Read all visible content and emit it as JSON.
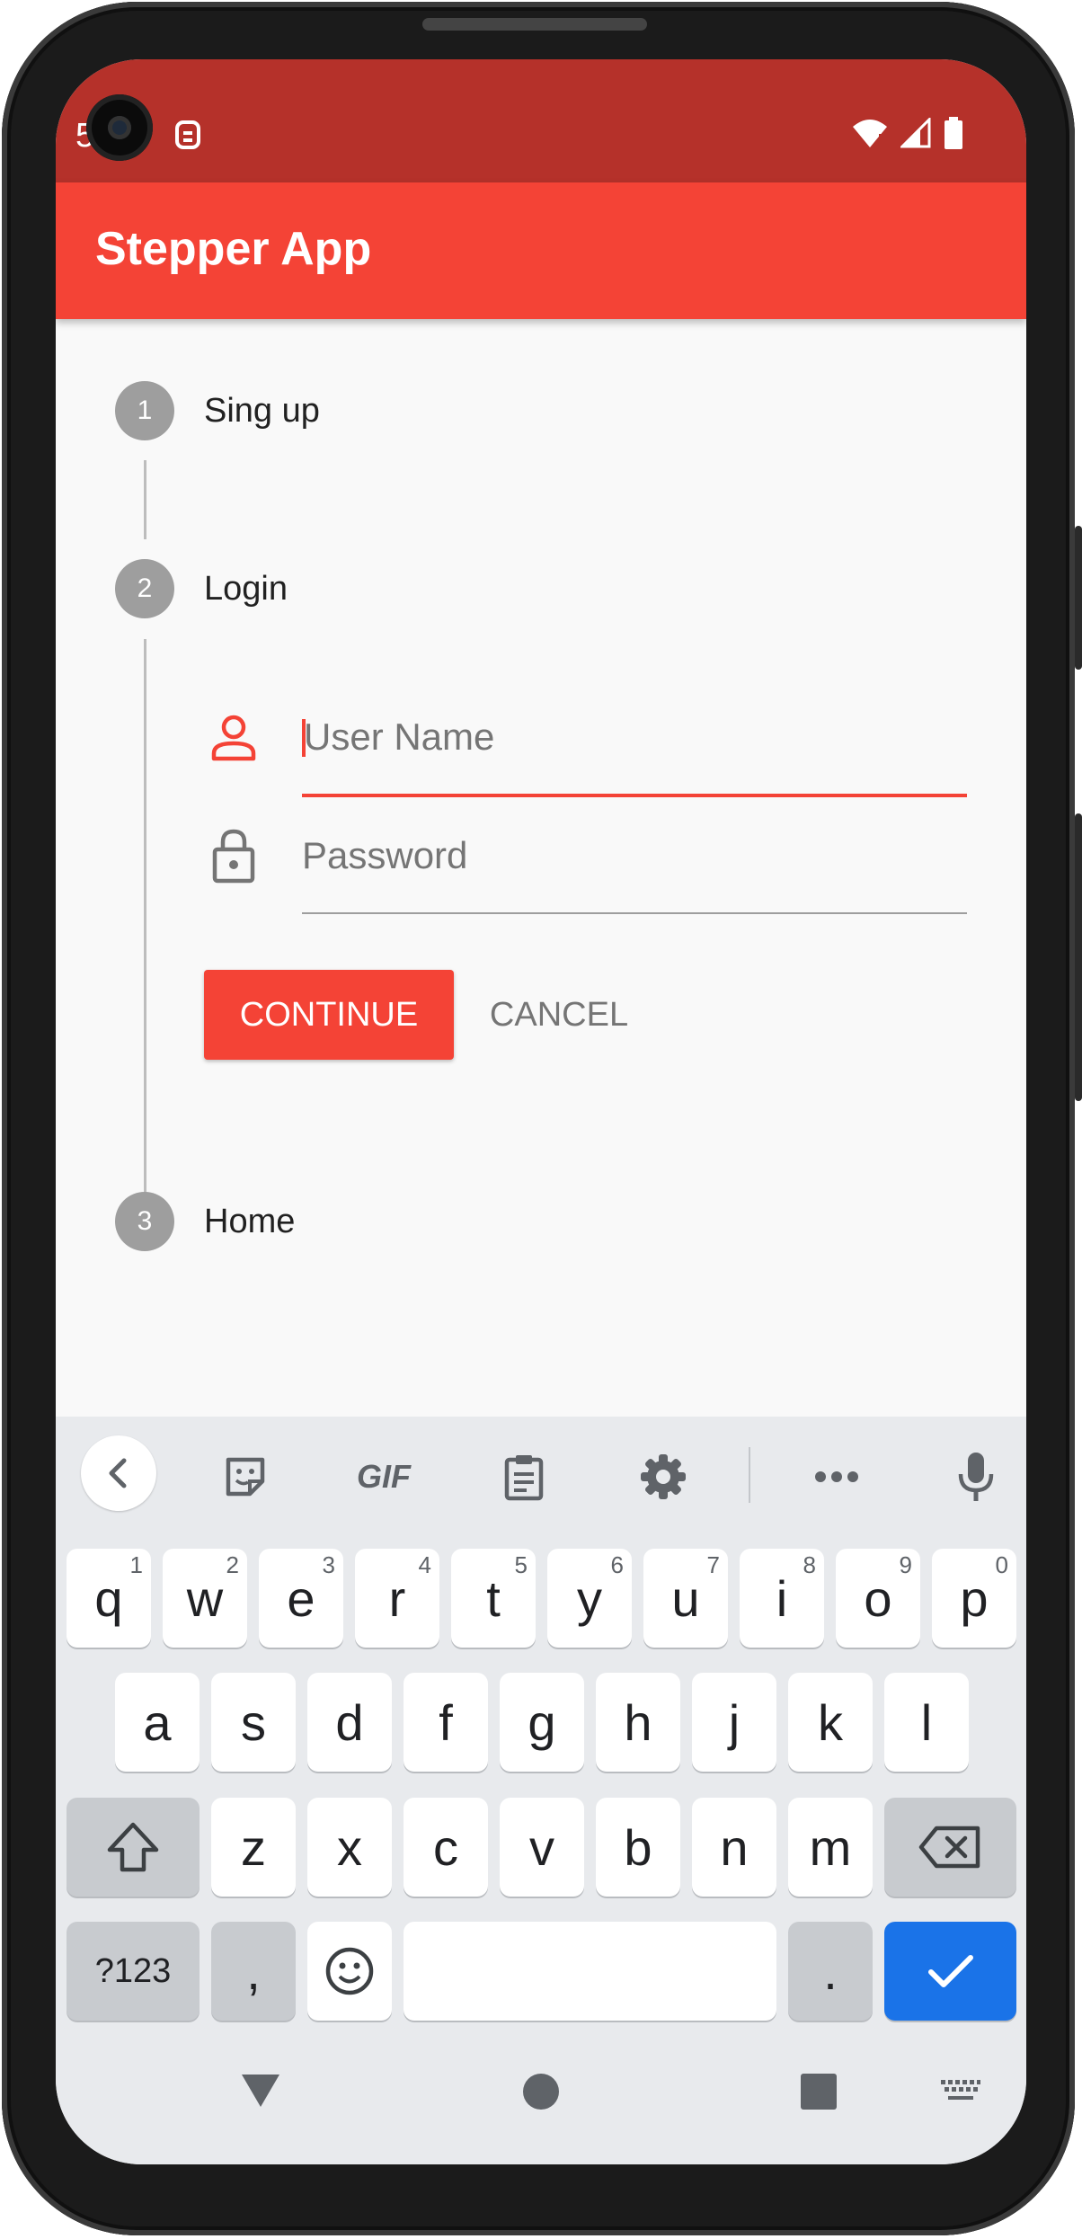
{
  "status_bar": {
    "time_partial": "5",
    "background": "#b5312a"
  },
  "app_bar": {
    "title": "Stepper App",
    "color": "#f44336"
  },
  "stepper": {
    "steps": [
      {
        "number": "1",
        "title": "Sing up"
      },
      {
        "number": "2",
        "title": "Login"
      },
      {
        "number": "3",
        "title": "Home"
      }
    ],
    "active_step": 2
  },
  "form": {
    "username": {
      "placeholder": "User Name",
      "value": "",
      "icon": "person-outline-icon"
    },
    "password": {
      "placeholder": "Password",
      "value": "",
      "icon": "lock-outline-icon"
    }
  },
  "buttons": {
    "continue_label": "CONTINUE",
    "cancel_label": "CANCEL"
  },
  "keyboard": {
    "toolbar": {
      "gif_label": "GIF",
      "icons": [
        "back-chevron-icon",
        "sticker-icon",
        "gif-icon",
        "clipboard-icon",
        "settings-icon",
        "more-icon",
        "microphone-icon"
      ]
    },
    "row1": [
      "q",
      "w",
      "e",
      "r",
      "t",
      "y",
      "u",
      "i",
      "o",
      "p"
    ],
    "row1_hints": [
      "1",
      "2",
      "3",
      "4",
      "5",
      "6",
      "7",
      "8",
      "9",
      "0"
    ],
    "row2": [
      "a",
      "s",
      "d",
      "f",
      "g",
      "h",
      "j",
      "k",
      "l"
    ],
    "row3": [
      "z",
      "x",
      "c",
      "v",
      "b",
      "n",
      "m"
    ],
    "symbols_label": "?123",
    "comma": ",",
    "period": ".",
    "accent": "#1a73e8"
  }
}
